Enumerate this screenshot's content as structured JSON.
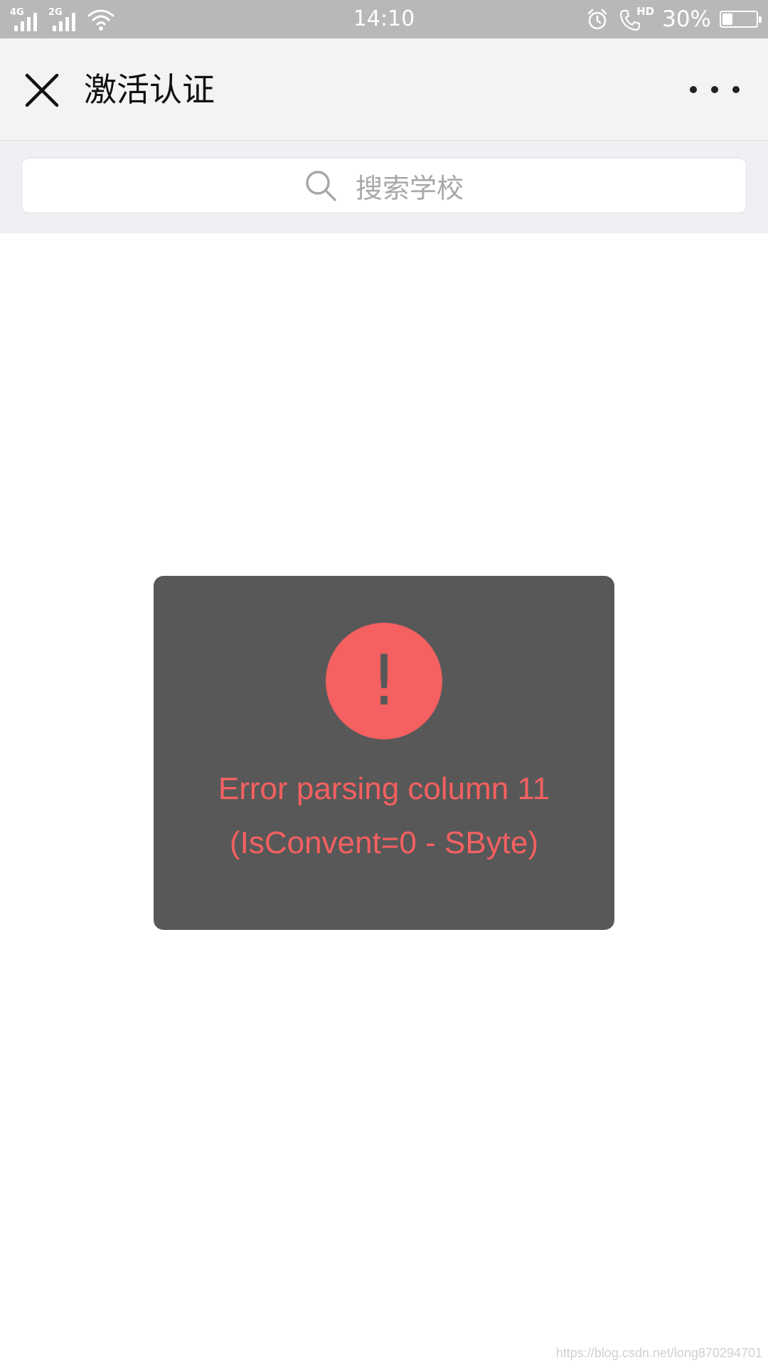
{
  "status_bar": {
    "network_1": "4G",
    "network_2": "2G",
    "time": "14:10",
    "hd_label": "HD",
    "battery_text": "30%",
    "battery_level": 0.3,
    "icons": [
      "signal-icon",
      "wifi-icon",
      "alarm-icon",
      "hd-call-icon",
      "battery-icon"
    ]
  },
  "nav": {
    "title": "激活认证",
    "icons": [
      "close-icon",
      "more-icon"
    ]
  },
  "search": {
    "placeholder": "搜索学校",
    "icon": "search-icon"
  },
  "toast": {
    "icon": "exclamation-icon",
    "mark": "!",
    "message_line1": "Error parsing column 11",
    "message_line2": "(IsConvent=0 - SByte)"
  },
  "watermark": "https://blog.csdn.net/long870294701",
  "colors": {
    "status_bar_bg": "#b8b8b8",
    "nav_bg": "#f3f3f3",
    "search_area_bg": "#efeff4",
    "toast_bg": "#585858",
    "error_red": "#f56060"
  }
}
